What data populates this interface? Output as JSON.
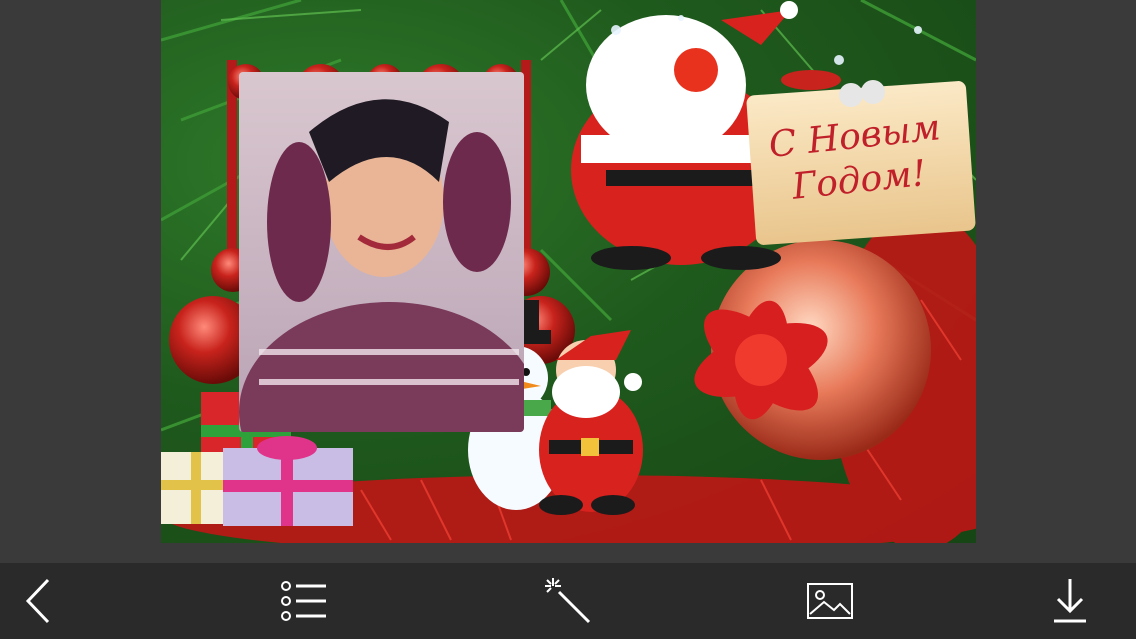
{
  "card": {
    "greeting": "С Новым\nГодом!"
  },
  "toolbar": {
    "buttons": [
      {
        "icon": "chevron-left-icon"
      },
      {
        "icon": "list-icon"
      },
      {
        "icon": "magic-wand-icon"
      },
      {
        "icon": "image-icon"
      },
      {
        "icon": "download-icon"
      }
    ]
  },
  "colors": {
    "background": "#3a3a3a",
    "toolbar": "#2a2a2a",
    "icon": "#ffffff",
    "greeting_text": "#c0202a"
  }
}
